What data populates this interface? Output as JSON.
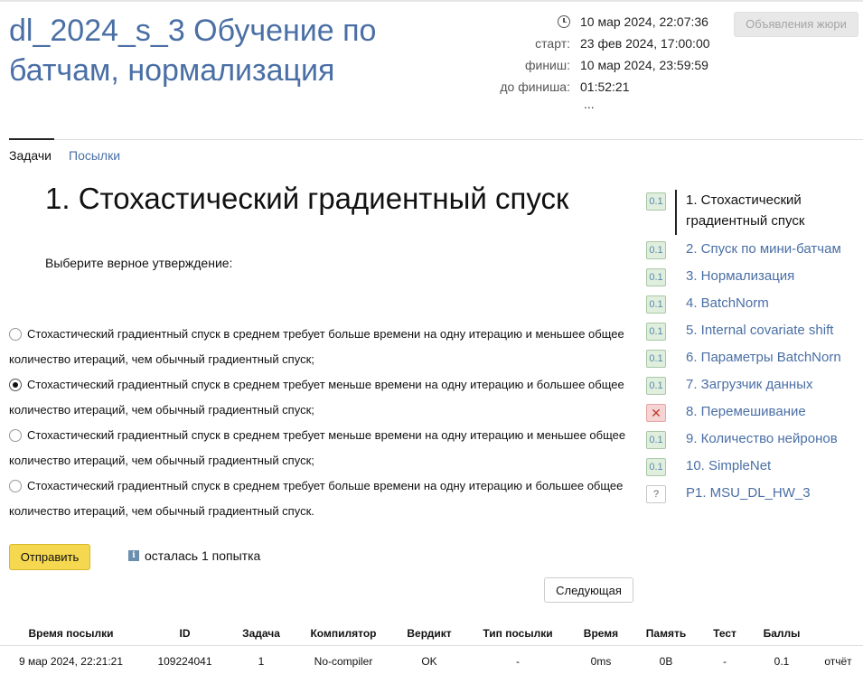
{
  "header": {
    "title": "dl_2024_s_3 Обучение по батчам, нормализация",
    "current_time": "10 мар 2024, 22:07:36",
    "start_label": "старт:",
    "start_value": "23 фев 2024, 17:00:00",
    "finish_label": "финиш:",
    "finish_value": "10 мар 2024, 23:59:59",
    "remaining_label": "до финиша:",
    "remaining_value": "01:52:21",
    "more": "...",
    "jury_button": "Объявления жюри"
  },
  "tabs": [
    {
      "label": "Задачи",
      "active": true
    },
    {
      "label": "Посылки",
      "active": false
    }
  ],
  "problem": {
    "title": "1. Стохастический градиентный спуск",
    "question": "Выберите верное утверждение:",
    "options": [
      {
        "text": "Стохастический градиентный спуск в среднем требует больше времени на одну итерацию и меньшее общее количество итераций, чем обычный градиентный спуск;",
        "selected": false
      },
      {
        "text": "Стохастический градиентный спуск в среднем требует меньше времени на одну итерацию и большее общее количество итераций, чем обычный градиентный спуск;",
        "selected": true
      },
      {
        "text": "Стохастический градиентный спуск в среднем требует меньше времени на одну итерацию и меньшее общее количество итераций, чем обычный градиентный спуск;",
        "selected": false
      },
      {
        "text": "Стохастический градиентный спуск в среднем требует больше времени на одну итерацию и большее общее количество итераций, чем обычный градиентный спуск.",
        "selected": false
      }
    ],
    "submit_label": "Отправить",
    "attempts_icon": "info-icon",
    "attempts_text": "осталась 1 попытка",
    "next_label": "Следующая"
  },
  "sidebar": {
    "items": [
      {
        "badge": "0.1",
        "status": "ok",
        "label": "1. Стохастический градиентный спуск",
        "active": true
      },
      {
        "badge": "0.1",
        "status": "ok",
        "label": "2. Спуск по мини-батчам"
      },
      {
        "badge": "0.1",
        "status": "ok",
        "label": "3. Нормализация"
      },
      {
        "badge": "0.1",
        "status": "ok",
        "label": "4. BatchNorm"
      },
      {
        "badge": "0.1",
        "status": "ok",
        "label": "5. Internal covariate shift"
      },
      {
        "badge": "0.1",
        "status": "ok",
        "label": "6. Параметры BatchNorn"
      },
      {
        "badge": "0.1",
        "status": "ok",
        "label": "7. Загрузчик данных"
      },
      {
        "badge": "✕",
        "status": "fail",
        "label": "8. Перемешивание"
      },
      {
        "badge": "0.1",
        "status": "ok",
        "label": "9. Количество нейронов"
      },
      {
        "badge": "0.1",
        "status": "ok",
        "label": "10. SimpleNet"
      },
      {
        "badge": "?",
        "status": "unknown",
        "label": "P1. MSU_DL_HW_3"
      }
    ]
  },
  "submissions": {
    "headers": [
      "Время посылки",
      "ID",
      "Задача",
      "Компилятор",
      "Вердикт",
      "Тип посылки",
      "Время",
      "Память",
      "Тест",
      "Баллы"
    ],
    "rows": [
      {
        "time": "9 мар 2024, 22:21:21",
        "id": "109224041",
        "task": "1",
        "compiler": "No-compiler",
        "verdict": "OK",
        "type": "-",
        "runtime": "0ms",
        "memory": "0B",
        "test": "-",
        "score": "0.1",
        "report": "отчёт"
      }
    ]
  },
  "colors": {
    "link": "#4a6fa5",
    "accent_button": "#f5d84f",
    "ok_badge": "#dfeedd",
    "fail_badge": "#f6d4d4",
    "verdict_ok": "#3c8a2e"
  }
}
